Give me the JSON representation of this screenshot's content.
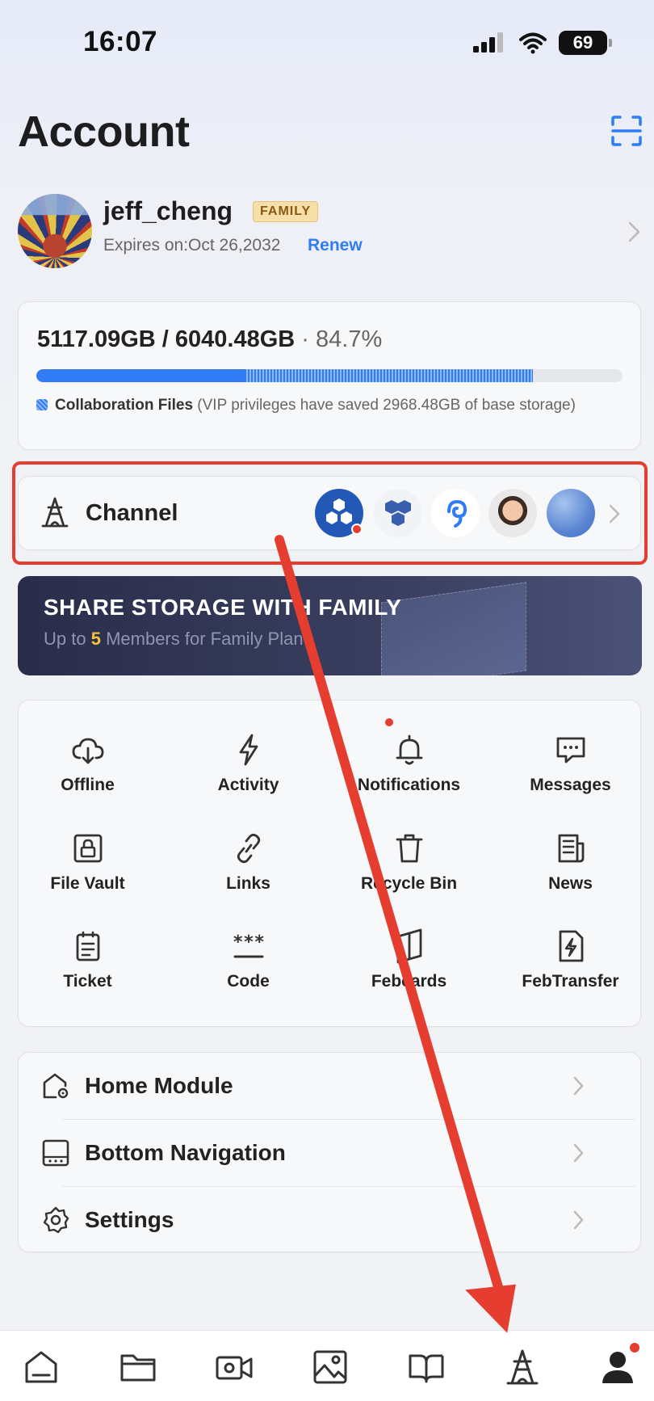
{
  "status_bar": {
    "time": "16:07",
    "battery": "69"
  },
  "header": {
    "title": "Account"
  },
  "profile": {
    "username": "jeff_cheng",
    "plan_badge": "FAMILY",
    "expires": "Expires on:Oct 26,2032",
    "renew_label": "Renew"
  },
  "storage": {
    "usage_text": "5117.09GB / 6040.48GB",
    "separator": " · ",
    "percent_text": "84.7%",
    "used_fraction": 0.847,
    "collab_fraction": 0.491,
    "legend_label": "Collaboration Files",
    "legend_note": " (VIP privileges have saved 2968.48GB of base storage)"
  },
  "channel": {
    "label": "Channel"
  },
  "banner": {
    "title": "SHARE STORAGE WITH FAMILY",
    "sub_prefix": "Up to ",
    "sub_count": "5",
    "sub_suffix": " Members for Family Plan"
  },
  "tools": [
    {
      "label": "Offline",
      "icon": "cloud-download-icon"
    },
    {
      "label": "Activity",
      "icon": "lightning-icon"
    },
    {
      "label": "Notifications",
      "icon": "bell-icon"
    },
    {
      "label": "Messages",
      "icon": "chat-bubble-icon"
    },
    {
      "label": "File Vault",
      "icon": "lock-icon"
    },
    {
      "label": "Links",
      "icon": "link-icon"
    },
    {
      "label": "Recycle Bin",
      "icon": "trash-icon"
    },
    {
      "label": "News",
      "icon": "newspaper-icon"
    },
    {
      "label": "Ticket",
      "icon": "clipboard-icon"
    },
    {
      "label": "Code",
      "icon": "asterisk-code-icon"
    },
    {
      "label": "Febcards",
      "icon": "book-card-icon"
    },
    {
      "label": "FebTransfer",
      "icon": "file-bolt-icon"
    }
  ],
  "settings_list": [
    {
      "label": "Home Module",
      "icon": "home-gear-icon"
    },
    {
      "label": "Bottom Navigation",
      "icon": "bottom-bar-icon"
    },
    {
      "label": "Settings",
      "icon": "gear-icon"
    }
  ],
  "bottom_nav": [
    {
      "icon": "home-icon"
    },
    {
      "icon": "folder-icon"
    },
    {
      "icon": "video-icon"
    },
    {
      "icon": "photo-icon"
    },
    {
      "icon": "book-icon"
    },
    {
      "icon": "tower-icon"
    },
    {
      "icon": "person-icon"
    }
  ],
  "colors": {
    "accent": "#2f7cf6",
    "highlight_red": "#e53d2f",
    "badge_gold": "#f6dfa9"
  }
}
